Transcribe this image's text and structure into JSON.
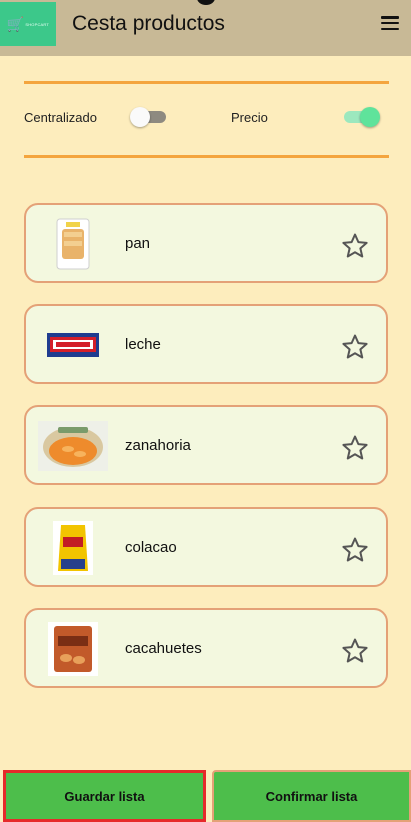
{
  "app": {
    "title": "Cesta productos",
    "logo_text": "SHOPCART"
  },
  "toggles": {
    "centralizado": {
      "label": "Centralizado",
      "on": false
    },
    "precio": {
      "label": "Precio",
      "on": true
    }
  },
  "products": [
    {
      "name": "pan",
      "image": "bread-package",
      "favorite": false
    },
    {
      "name": "leche",
      "image": "crunch-bar",
      "favorite": false
    },
    {
      "name": "zanahoria",
      "image": "snack-bowl",
      "favorite": false
    },
    {
      "name": "colacao",
      "image": "yellow-bag",
      "favorite": false
    },
    {
      "name": "cacahuetes",
      "image": "nuts-bag",
      "favorite": false
    }
  ],
  "buttons": {
    "save": "Guardar lista",
    "confirm": "Confirmar lista"
  },
  "colors": {
    "background": "#fdedbd",
    "appbar": "#c8b996",
    "accent_rule": "#f4a53e",
    "card_border": "#e4a177",
    "card_fill": "#f3f8df",
    "button_green": "#4dbe4b",
    "highlight_red": "#e62a2a"
  }
}
